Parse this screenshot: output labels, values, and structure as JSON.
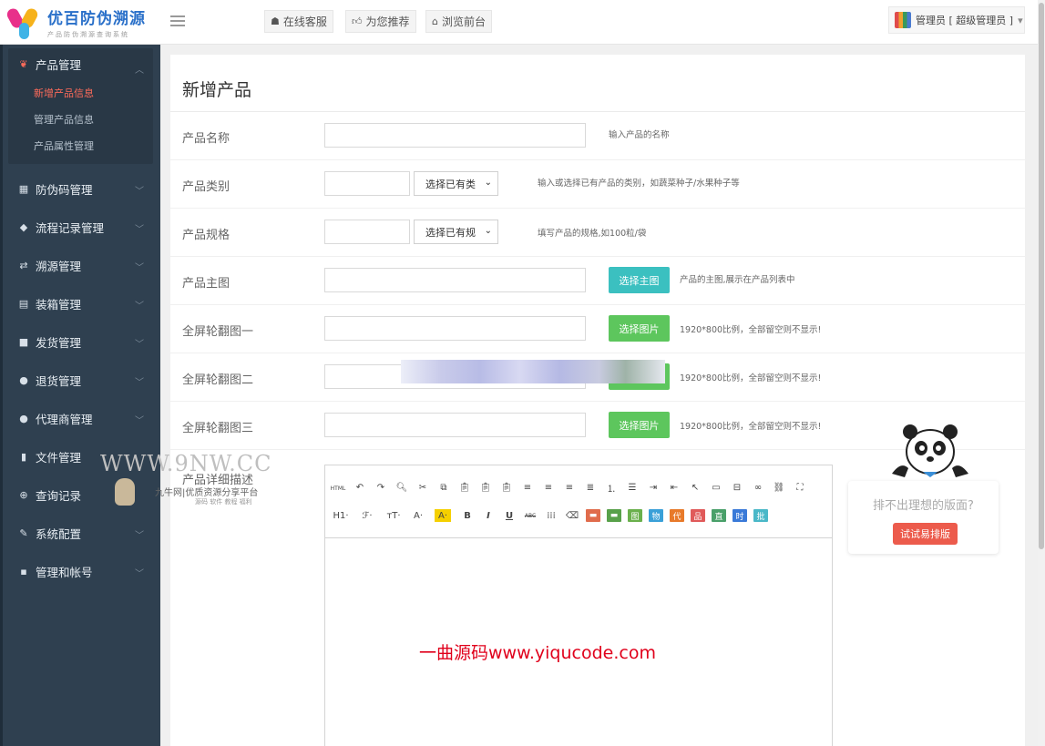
{
  "brand": {
    "name": "优百防伪溯源",
    "tagline": "产品防伪溯源查询系统"
  },
  "topnav": [
    {
      "label": "在线客服",
      "icon": "robot-icon"
    },
    {
      "label": "为您推荐",
      "icon": "thumbs-up-icon"
    },
    {
      "label": "浏览前台",
      "icon": "home-icon"
    }
  ],
  "user": {
    "label": "管理员 [ 超级管理员 ]",
    "caret": "▾"
  },
  "sidebar": {
    "product": {
      "label": "产品管理",
      "subs": [
        "新增产品信息",
        "管理产品信息",
        "产品属性管理"
      ]
    },
    "items": [
      {
        "label": "防伪码管理",
        "icon": "qrcode-icon",
        "glyph": "▦"
      },
      {
        "label": "流程记录管理",
        "icon": "tags-icon",
        "glyph": "◆"
      },
      {
        "label": "溯源管理",
        "icon": "retweet-icon",
        "glyph": "⇄"
      },
      {
        "label": "装箱管理",
        "icon": "grid-icon",
        "glyph": "▤"
      },
      {
        "label": "发货管理",
        "icon": "truck-icon",
        "glyph": "■"
      },
      {
        "label": "退货管理",
        "icon": "minus-circle-icon",
        "glyph": "●"
      },
      {
        "label": "代理商管理",
        "icon": "users-icon",
        "glyph": "●"
      },
      {
        "label": "文件管理",
        "icon": "file-icon",
        "glyph": "▮"
      },
      {
        "label": "查询记录",
        "icon": "search-plus-icon",
        "glyph": "⊕"
      },
      {
        "label": "系统配置",
        "icon": "wrench-icon",
        "glyph": "✎"
      },
      {
        "label": "管理和帐号",
        "icon": "lock-icon",
        "glyph": "▪"
      }
    ]
  },
  "form": {
    "title": "新增产品",
    "name": {
      "label": "产品名称",
      "hint": "输入产品的名称"
    },
    "category": {
      "label": "产品类别",
      "select": "选择已有类",
      "hint": "输入或选择已有产品的类别，如蔬菜种子/水果种子等"
    },
    "spec": {
      "label": "产品规格",
      "select": "选择已有规",
      "hint": "填写产品的规格,如100粒/袋"
    },
    "main_image": {
      "label": "产品主图",
      "button": "选择主图",
      "hint": "产品的主图,展示在产品列表中"
    },
    "banner1": {
      "label": "全屏轮翻图一",
      "button": "选择图片",
      "hint": "1920*800比例，全部留空则不显示!"
    },
    "banner2": {
      "label": "全屏轮翻图二",
      "button": "选择图片",
      "hint": "1920*800比例，全部留空则不显示!"
    },
    "banner3": {
      "label": "全屏轮翻图三",
      "button": "选择图片",
      "hint": "1920*800比例，全部留空则不显示!"
    },
    "detail": {
      "label": "产品详细描述"
    }
  },
  "editor_toolbar": {
    "row2": [
      "H1·",
      "ℱ·",
      "тT·",
      "A·",
      "A·",
      "B",
      "I",
      "U",
      "ABC",
      "⁞⁞⁞",
      "⌫",
      "▬",
      "▬",
      "图",
      "物",
      "代",
      "品",
      "直",
      "时",
      "批"
    ]
  },
  "ad": {
    "text": "排不出理想的版面?",
    "button": "试试易排版"
  },
  "watermarks": {
    "w1": "WWW.9NW.CC",
    "w2": "九牛网|优质资源分享平台",
    "w3": "源码 软件 教程 福利",
    "center": "一曲源码www.yiqucode.com"
  },
  "colors": {
    "sidebar": "#2f4050",
    "active": "#ff6b5a",
    "teal_btn": "#3bc0c0",
    "green_btn": "#5dc65d",
    "ad_btn": "#ec5b4c"
  }
}
